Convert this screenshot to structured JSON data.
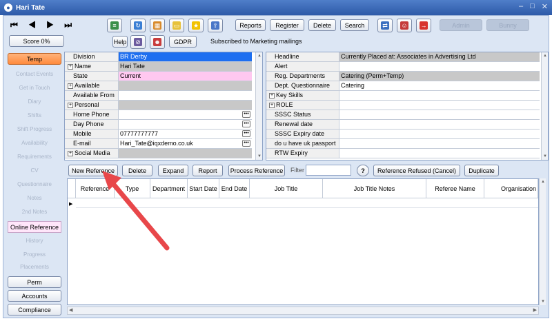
{
  "window": {
    "title": "Hari Tate",
    "controls": [
      "–",
      "□",
      "✕"
    ]
  },
  "toolbar": {
    "nav": [
      "⏮",
      "◀",
      "▶",
      "⏭"
    ],
    "score": "Score 0%",
    "help": "Help",
    "gdpr": "GDPR",
    "marketing": "Subscribed to Marketing mailings",
    "reports": "Reports",
    "register": "Register",
    "delete": "Delete",
    "search": "Search",
    "ghost1": "Admin",
    "ghost2": "Bunny"
  },
  "sidebar": {
    "active_tab": "Temp",
    "items": [
      "Contact Events",
      "Get in Touch",
      "Diary",
      "Shifts",
      "Shift Progress",
      "Availability",
      "Requirements",
      "CV",
      "Questionnaire",
      "Notes",
      "2nd Notes",
      "Online Reference",
      "History",
      "Progress",
      "Placements"
    ],
    "bottom": [
      "Perm",
      "Accounts",
      "Compliance"
    ]
  },
  "left_fields": [
    {
      "label": "Division",
      "value": "BR Derby",
      "expand": false,
      "ellipsis": false
    },
    {
      "label": "Name",
      "value": "Hari Tate",
      "expand": true,
      "ellipsis": false
    },
    {
      "label": "State",
      "value": "Current",
      "expand": false,
      "ellipsis": false
    },
    {
      "label": "Available",
      "value": "",
      "expand": true,
      "ellipsis": false
    },
    {
      "label": "Available From",
      "value": "",
      "expand": false,
      "ellipsis": false
    },
    {
      "label": "Personal",
      "value": "",
      "expand": true,
      "ellipsis": false
    },
    {
      "label": "Home Phone",
      "value": "",
      "expand": false,
      "ellipsis": true
    },
    {
      "label": "Day Phone",
      "value": "",
      "expand": false,
      "ellipsis": true
    },
    {
      "label": "Mobile",
      "value": "07777777777",
      "expand": false,
      "ellipsis": true
    },
    {
      "label": "E-mail",
      "value": "Hari_Tate@iqxdemo.co.uk",
      "expand": false,
      "ellipsis": true
    },
    {
      "label": "Social Media",
      "value": "",
      "expand": true,
      "ellipsis": false
    }
  ],
  "right_fields": [
    {
      "label": "Headline",
      "value": "Currently Placed at: Associates in Advertising Ltd",
      "expand": false
    },
    {
      "label": "Alert",
      "value": "",
      "expand": false
    },
    {
      "label": "Reg. Departments",
      "value": "Catering (Perm+Temp)",
      "expand": false
    },
    {
      "label": "Dept. Questionnaire",
      "value": "Catering",
      "expand": false
    },
    {
      "label": "Key Skills",
      "value": "",
      "expand": true
    },
    {
      "label": "ROLE",
      "value": "",
      "expand": true
    },
    {
      "label": "SSSC Status",
      "value": "",
      "expand": false
    },
    {
      "label": "Renewal date",
      "value": "",
      "expand": false
    },
    {
      "label": "SSSC Expiry date",
      "value": "",
      "expand": false
    },
    {
      "label": "do u have uk passport",
      "value": "",
      "expand": false
    },
    {
      "label": "RTW Expiry",
      "value": "",
      "expand": false
    }
  ],
  "reference_bar": {
    "new": "New Reference",
    "delete": "Delete",
    "expand": "Expand",
    "report": "Report",
    "process": "Process Reference",
    "filter_label": "Filter",
    "filter_value": "",
    "help": "?",
    "refused": "Reference Refused (Cancel)",
    "duplicate": "Duplicate"
  },
  "table": {
    "columns": [
      "Reference",
      "Type",
      "Department",
      "Start Date",
      "End Date",
      "Job Title",
      "Job Title Notes",
      "Referee Name",
      "Organisation"
    ],
    "rows": []
  },
  "colors": {
    "selected_blue": "#1e6ff0",
    "state_pink": "#ffc8f0",
    "temp_orange": "#ff8a3d",
    "arrow_red": "#e8474a"
  }
}
